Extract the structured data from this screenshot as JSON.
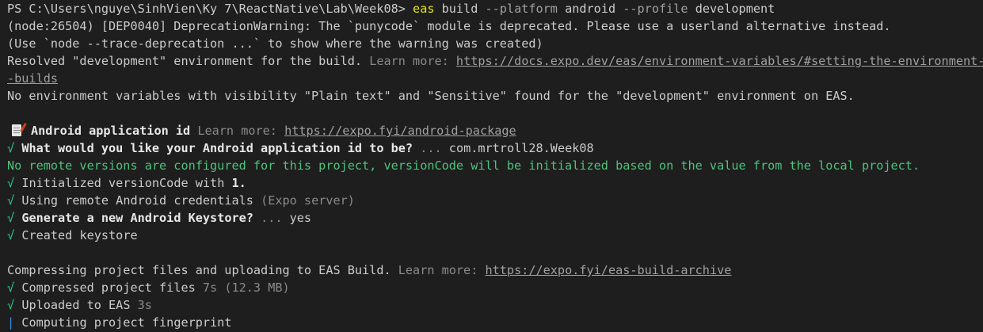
{
  "terminal": {
    "prompt": "PS C:\\Users\\nguye\\SinhVien\\Ky 7\\ReactNative\\Lab\\Week08> ",
    "cmd_name": "eas",
    "cmd_sub": " build",
    "flag1": " --platform",
    "flag1_val": " android",
    "flag2": " --profile",
    "flag2_val": " development",
    "warn1": "(node:26504) [DEP0040] DeprecationWarning: The `punycode` module is deprecated. Please use a userland alternative instead.",
    "warn2": "(Use `node --trace-deprecation ...` to show where the warning was created)",
    "resolved_text": "Resolved \"development\" environment for the build. ",
    "learn_more": "Learn more: ",
    "env_link_part1": "https://docs.expo.dev/eas/environment-variables/#setting-the-environment-fo",
    "env_link_part2": "-builds",
    "no_env_vars": "No environment variables with visibility \"Plain text\" and \"Sensitive\" found for the \"development\" environment on EAS.",
    "android_id_heading": "Android application id",
    "android_id_link": "https://expo.fyi/android-package",
    "check_mark": "√",
    "q_app_id": "What would you like your Android application id to be?",
    "q_app_id_dots": " ... ",
    "q_app_id_answer": "com.mrtroll28.Week08",
    "no_remote_versions": "No remote versions are configured for this project, versionCode will be initialized based on the value from the local project.",
    "init_version_prefix": "Initialized versionCode with ",
    "init_version_value": "1.",
    "using_creds": "Using remote Android credentials ",
    "using_creds_dim": "(Expo server)",
    "gen_keystore": "Generate a new Android Keystore?",
    "gen_keystore_dots": " ... ",
    "gen_keystore_answer": "yes",
    "created_keystore": "Created keystore",
    "compressing": "Compressing project files and uploading to EAS Build. ",
    "archive_link": "https://expo.fyi/eas-build-archive",
    "compressed": "Compressed project files ",
    "compressed_dim": "7s (12.3 MB)",
    "uploaded": "Uploaded to EAS ",
    "uploaded_dim": "3s",
    "spinner_char": "|",
    "computing": " Computing project fingerprint"
  },
  "colors": {
    "background": "#1e1e1e",
    "foreground": "#cccccc",
    "command_yellow": "#e5e510",
    "success_green": "#23d18b",
    "dim_gray": "#8a8a8a",
    "spinner_blue": "#3b8eea"
  }
}
